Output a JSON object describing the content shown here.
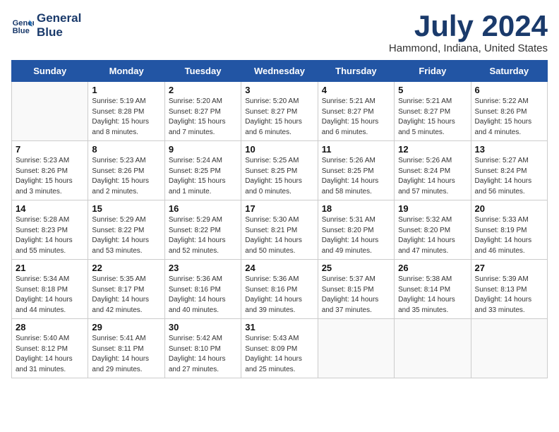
{
  "header": {
    "logo_line1": "General",
    "logo_line2": "Blue",
    "month_title": "July 2024",
    "location": "Hammond, Indiana, United States"
  },
  "weekdays": [
    "Sunday",
    "Monday",
    "Tuesday",
    "Wednesday",
    "Thursday",
    "Friday",
    "Saturday"
  ],
  "weeks": [
    [
      {
        "day": "",
        "info": ""
      },
      {
        "day": "1",
        "info": "Sunrise: 5:19 AM\nSunset: 8:28 PM\nDaylight: 15 hours\nand 8 minutes."
      },
      {
        "day": "2",
        "info": "Sunrise: 5:20 AM\nSunset: 8:27 PM\nDaylight: 15 hours\nand 7 minutes."
      },
      {
        "day": "3",
        "info": "Sunrise: 5:20 AM\nSunset: 8:27 PM\nDaylight: 15 hours\nand 6 minutes."
      },
      {
        "day": "4",
        "info": "Sunrise: 5:21 AM\nSunset: 8:27 PM\nDaylight: 15 hours\nand 6 minutes."
      },
      {
        "day": "5",
        "info": "Sunrise: 5:21 AM\nSunset: 8:27 PM\nDaylight: 15 hours\nand 5 minutes."
      },
      {
        "day": "6",
        "info": "Sunrise: 5:22 AM\nSunset: 8:26 PM\nDaylight: 15 hours\nand 4 minutes."
      }
    ],
    [
      {
        "day": "7",
        "info": "Sunrise: 5:23 AM\nSunset: 8:26 PM\nDaylight: 15 hours\nand 3 minutes."
      },
      {
        "day": "8",
        "info": "Sunrise: 5:23 AM\nSunset: 8:26 PM\nDaylight: 15 hours\nand 2 minutes."
      },
      {
        "day": "9",
        "info": "Sunrise: 5:24 AM\nSunset: 8:25 PM\nDaylight: 15 hours\nand 1 minute."
      },
      {
        "day": "10",
        "info": "Sunrise: 5:25 AM\nSunset: 8:25 PM\nDaylight: 15 hours\nand 0 minutes."
      },
      {
        "day": "11",
        "info": "Sunrise: 5:26 AM\nSunset: 8:25 PM\nDaylight: 14 hours\nand 58 minutes."
      },
      {
        "day": "12",
        "info": "Sunrise: 5:26 AM\nSunset: 8:24 PM\nDaylight: 14 hours\nand 57 minutes."
      },
      {
        "day": "13",
        "info": "Sunrise: 5:27 AM\nSunset: 8:24 PM\nDaylight: 14 hours\nand 56 minutes."
      }
    ],
    [
      {
        "day": "14",
        "info": "Sunrise: 5:28 AM\nSunset: 8:23 PM\nDaylight: 14 hours\nand 55 minutes."
      },
      {
        "day": "15",
        "info": "Sunrise: 5:29 AM\nSunset: 8:22 PM\nDaylight: 14 hours\nand 53 minutes."
      },
      {
        "day": "16",
        "info": "Sunrise: 5:29 AM\nSunset: 8:22 PM\nDaylight: 14 hours\nand 52 minutes."
      },
      {
        "day": "17",
        "info": "Sunrise: 5:30 AM\nSunset: 8:21 PM\nDaylight: 14 hours\nand 50 minutes."
      },
      {
        "day": "18",
        "info": "Sunrise: 5:31 AM\nSunset: 8:20 PM\nDaylight: 14 hours\nand 49 minutes."
      },
      {
        "day": "19",
        "info": "Sunrise: 5:32 AM\nSunset: 8:20 PM\nDaylight: 14 hours\nand 47 minutes."
      },
      {
        "day": "20",
        "info": "Sunrise: 5:33 AM\nSunset: 8:19 PM\nDaylight: 14 hours\nand 46 minutes."
      }
    ],
    [
      {
        "day": "21",
        "info": "Sunrise: 5:34 AM\nSunset: 8:18 PM\nDaylight: 14 hours\nand 44 minutes."
      },
      {
        "day": "22",
        "info": "Sunrise: 5:35 AM\nSunset: 8:17 PM\nDaylight: 14 hours\nand 42 minutes."
      },
      {
        "day": "23",
        "info": "Sunrise: 5:36 AM\nSunset: 8:16 PM\nDaylight: 14 hours\nand 40 minutes."
      },
      {
        "day": "24",
        "info": "Sunrise: 5:36 AM\nSunset: 8:16 PM\nDaylight: 14 hours\nand 39 minutes."
      },
      {
        "day": "25",
        "info": "Sunrise: 5:37 AM\nSunset: 8:15 PM\nDaylight: 14 hours\nand 37 minutes."
      },
      {
        "day": "26",
        "info": "Sunrise: 5:38 AM\nSunset: 8:14 PM\nDaylight: 14 hours\nand 35 minutes."
      },
      {
        "day": "27",
        "info": "Sunrise: 5:39 AM\nSunset: 8:13 PM\nDaylight: 14 hours\nand 33 minutes."
      }
    ],
    [
      {
        "day": "28",
        "info": "Sunrise: 5:40 AM\nSunset: 8:12 PM\nDaylight: 14 hours\nand 31 minutes."
      },
      {
        "day": "29",
        "info": "Sunrise: 5:41 AM\nSunset: 8:11 PM\nDaylight: 14 hours\nand 29 minutes."
      },
      {
        "day": "30",
        "info": "Sunrise: 5:42 AM\nSunset: 8:10 PM\nDaylight: 14 hours\nand 27 minutes."
      },
      {
        "day": "31",
        "info": "Sunrise: 5:43 AM\nSunset: 8:09 PM\nDaylight: 14 hours\nand 25 minutes."
      },
      {
        "day": "",
        "info": ""
      },
      {
        "day": "",
        "info": ""
      },
      {
        "day": "",
        "info": ""
      }
    ]
  ]
}
